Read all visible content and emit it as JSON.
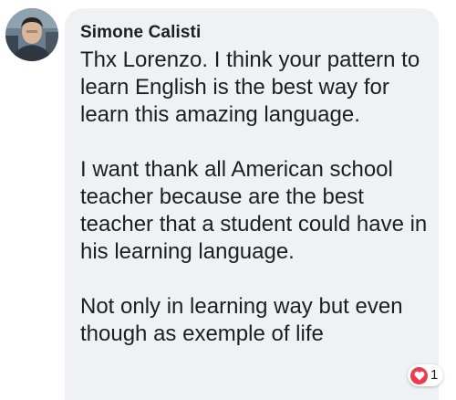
{
  "comment": {
    "author": "Simone Calisti",
    "paragraphs": [
      "Thx Lorenzo. I think your pattern to learn English is the best way for learn this amazing language.",
      "I want thank all American school teacher because are the best teacher that a student could have in his learning language.",
      "Not only in learning way but even though as exemple of life"
    ],
    "reaction": {
      "icon": "heart-icon",
      "count": "1",
      "color": "#ee3a4c"
    }
  }
}
